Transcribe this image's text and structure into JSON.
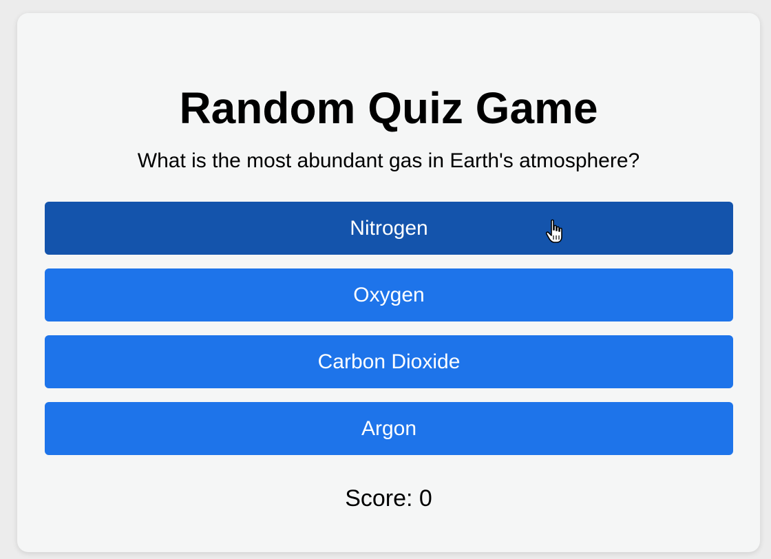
{
  "quiz": {
    "title": "Random Quiz Game",
    "question": "What is the most abundant gas in Earth's atmosphere?",
    "answers": [
      {
        "label": "Nitrogen",
        "hovered": true
      },
      {
        "label": "Oxygen",
        "hovered": false
      },
      {
        "label": "Carbon Dioxide",
        "hovered": false
      },
      {
        "label": "Argon",
        "hovered": false
      }
    ],
    "score_text": "Score: 0"
  },
  "colors": {
    "background": "#ececec",
    "card": "#f5f6f6",
    "button": "#1e74ea",
    "button_hover": "#1454ac",
    "button_text": "#ffffff"
  },
  "cursor": {
    "icon": "hand-pointer-icon"
  }
}
